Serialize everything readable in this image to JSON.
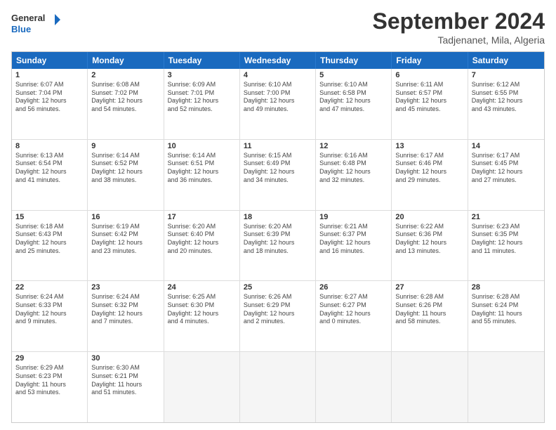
{
  "logo": {
    "text_general": "General",
    "text_blue": "Blue"
  },
  "title": "September 2024",
  "location": "Tadjenanet, Mila, Algeria",
  "headers": [
    "Sunday",
    "Monday",
    "Tuesday",
    "Wednesday",
    "Thursday",
    "Friday",
    "Saturday"
  ],
  "rows": [
    [
      {
        "day": "",
        "sunrise": "",
        "sunset": "",
        "daylight": "",
        "empty": true
      },
      {
        "day": "2",
        "sunrise": "Sunrise: 6:08 AM",
        "sunset": "Sunset: 7:02 PM",
        "daylight": "Daylight: 12 hours",
        "extra": "and 54 minutes."
      },
      {
        "day": "3",
        "sunrise": "Sunrise: 6:09 AM",
        "sunset": "Sunset: 7:01 PM",
        "daylight": "Daylight: 12 hours",
        "extra": "and 52 minutes."
      },
      {
        "day": "4",
        "sunrise": "Sunrise: 6:10 AM",
        "sunset": "Sunset: 7:00 PM",
        "daylight": "Daylight: 12 hours",
        "extra": "and 49 minutes."
      },
      {
        "day": "5",
        "sunrise": "Sunrise: 6:10 AM",
        "sunset": "Sunset: 6:58 PM",
        "daylight": "Daylight: 12 hours",
        "extra": "and 47 minutes."
      },
      {
        "day": "6",
        "sunrise": "Sunrise: 6:11 AM",
        "sunset": "Sunset: 6:57 PM",
        "daylight": "Daylight: 12 hours",
        "extra": "and 45 minutes."
      },
      {
        "day": "7",
        "sunrise": "Sunrise: 6:12 AM",
        "sunset": "Sunset: 6:55 PM",
        "daylight": "Daylight: 12 hours",
        "extra": "and 43 minutes."
      }
    ],
    [
      {
        "day": "8",
        "sunrise": "Sunrise: 6:13 AM",
        "sunset": "Sunset: 6:54 PM",
        "daylight": "Daylight: 12 hours",
        "extra": "and 41 minutes."
      },
      {
        "day": "9",
        "sunrise": "Sunrise: 6:14 AM",
        "sunset": "Sunset: 6:52 PM",
        "daylight": "Daylight: 12 hours",
        "extra": "and 38 minutes."
      },
      {
        "day": "10",
        "sunrise": "Sunrise: 6:14 AM",
        "sunset": "Sunset: 6:51 PM",
        "daylight": "Daylight: 12 hours",
        "extra": "and 36 minutes."
      },
      {
        "day": "11",
        "sunrise": "Sunrise: 6:15 AM",
        "sunset": "Sunset: 6:49 PM",
        "daylight": "Daylight: 12 hours",
        "extra": "and 34 minutes."
      },
      {
        "day": "12",
        "sunrise": "Sunrise: 6:16 AM",
        "sunset": "Sunset: 6:48 PM",
        "daylight": "Daylight: 12 hours",
        "extra": "and 32 minutes."
      },
      {
        "day": "13",
        "sunrise": "Sunrise: 6:17 AM",
        "sunset": "Sunset: 6:46 PM",
        "daylight": "Daylight: 12 hours",
        "extra": "and 29 minutes."
      },
      {
        "day": "14",
        "sunrise": "Sunrise: 6:17 AM",
        "sunset": "Sunset: 6:45 PM",
        "daylight": "Daylight: 12 hours",
        "extra": "and 27 minutes."
      }
    ],
    [
      {
        "day": "15",
        "sunrise": "Sunrise: 6:18 AM",
        "sunset": "Sunset: 6:43 PM",
        "daylight": "Daylight: 12 hours",
        "extra": "and 25 minutes."
      },
      {
        "day": "16",
        "sunrise": "Sunrise: 6:19 AM",
        "sunset": "Sunset: 6:42 PM",
        "daylight": "Daylight: 12 hours",
        "extra": "and 23 minutes."
      },
      {
        "day": "17",
        "sunrise": "Sunrise: 6:20 AM",
        "sunset": "Sunset: 6:40 PM",
        "daylight": "Daylight: 12 hours",
        "extra": "and 20 minutes."
      },
      {
        "day": "18",
        "sunrise": "Sunrise: 6:20 AM",
        "sunset": "Sunset: 6:39 PM",
        "daylight": "Daylight: 12 hours",
        "extra": "and 18 minutes."
      },
      {
        "day": "19",
        "sunrise": "Sunrise: 6:21 AM",
        "sunset": "Sunset: 6:37 PM",
        "daylight": "Daylight: 12 hours",
        "extra": "and 16 minutes."
      },
      {
        "day": "20",
        "sunrise": "Sunrise: 6:22 AM",
        "sunset": "Sunset: 6:36 PM",
        "daylight": "Daylight: 12 hours",
        "extra": "and 13 minutes."
      },
      {
        "day": "21",
        "sunrise": "Sunrise: 6:23 AM",
        "sunset": "Sunset: 6:35 PM",
        "daylight": "Daylight: 12 hours",
        "extra": "and 11 minutes."
      }
    ],
    [
      {
        "day": "22",
        "sunrise": "Sunrise: 6:24 AM",
        "sunset": "Sunset: 6:33 PM",
        "daylight": "Daylight: 12 hours",
        "extra": "and 9 minutes."
      },
      {
        "day": "23",
        "sunrise": "Sunrise: 6:24 AM",
        "sunset": "Sunset: 6:32 PM",
        "daylight": "Daylight: 12 hours",
        "extra": "and 7 minutes."
      },
      {
        "day": "24",
        "sunrise": "Sunrise: 6:25 AM",
        "sunset": "Sunset: 6:30 PM",
        "daylight": "Daylight: 12 hours",
        "extra": "and 4 minutes."
      },
      {
        "day": "25",
        "sunrise": "Sunrise: 6:26 AM",
        "sunset": "Sunset: 6:29 PM",
        "daylight": "Daylight: 12 hours",
        "extra": "and 2 minutes."
      },
      {
        "day": "26",
        "sunrise": "Sunrise: 6:27 AM",
        "sunset": "Sunset: 6:27 PM",
        "daylight": "Daylight: 12 hours",
        "extra": "and 0 minutes."
      },
      {
        "day": "27",
        "sunrise": "Sunrise: 6:28 AM",
        "sunset": "Sunset: 6:26 PM",
        "daylight": "Daylight: 11 hours",
        "extra": "and 58 minutes."
      },
      {
        "day": "28",
        "sunrise": "Sunrise: 6:28 AM",
        "sunset": "Sunset: 6:24 PM",
        "daylight": "Daylight: 11 hours",
        "extra": "and 55 minutes."
      }
    ],
    [
      {
        "day": "29",
        "sunrise": "Sunrise: 6:29 AM",
        "sunset": "Sunset: 6:23 PM",
        "daylight": "Daylight: 11 hours",
        "extra": "and 53 minutes."
      },
      {
        "day": "30",
        "sunrise": "Sunrise: 6:30 AM",
        "sunset": "Sunset: 6:21 PM",
        "daylight": "Daylight: 11 hours",
        "extra": "and 51 minutes."
      },
      {
        "day": "",
        "sunrise": "",
        "sunset": "",
        "daylight": "",
        "extra": "",
        "empty": true
      },
      {
        "day": "",
        "sunrise": "",
        "sunset": "",
        "daylight": "",
        "extra": "",
        "empty": true
      },
      {
        "day": "",
        "sunrise": "",
        "sunset": "",
        "daylight": "",
        "extra": "",
        "empty": true
      },
      {
        "day": "",
        "sunrise": "",
        "sunset": "",
        "daylight": "",
        "extra": "",
        "empty": true
      },
      {
        "day": "",
        "sunrise": "",
        "sunset": "",
        "daylight": "",
        "extra": "",
        "empty": true
      }
    ]
  ],
  "row0_day1": {
    "day": "1",
    "sunrise": "Sunrise: 6:07 AM",
    "sunset": "Sunset: 7:04 PM",
    "daylight": "Daylight: 12 hours",
    "extra": "and 56 minutes."
  }
}
